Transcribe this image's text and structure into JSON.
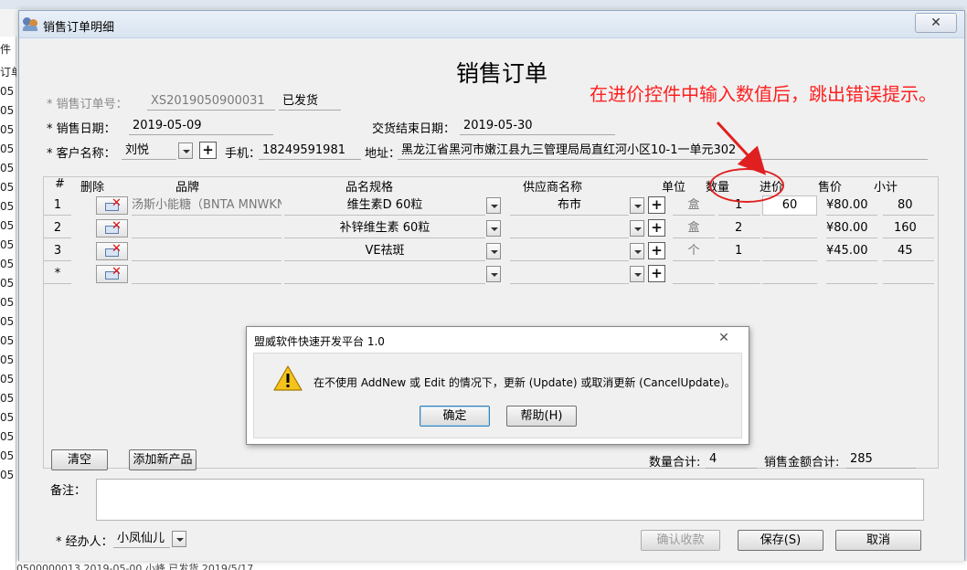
{
  "background": {
    "left_column": [
      "件",
      "",
      "订单",
      "05",
      "05",
      "05",
      "05",
      "05",
      "05",
      "05",
      "05",
      "05",
      "05",
      "05",
      "05",
      "05",
      "05",
      "05",
      "05",
      "05",
      "05",
      "05",
      "05",
      "05"
    ],
    "bottom_row": "0500000013    2019-05-00          小峰              已发货            2019/5/17"
  },
  "window": {
    "title": "销售订单明细",
    "close_glyph": "✕"
  },
  "form": {
    "heading": "销售订单",
    "annotation": "在进价控件中输入数值后，跳出错误提示。",
    "order_no_label": "* 销售订单号：",
    "order_no": "XS2019050900031",
    "status": "已发货",
    "sale_date_label": "* 销售日期：",
    "sale_date": "2019-05-09",
    "delivery_end_label": "交货结束日期：",
    "delivery_end": "2019-05-30",
    "customer_label": "* 客户名称：",
    "customer": "刘悦",
    "phone_label": "手机：",
    "phone": "18249591981",
    "address_label": "地址：",
    "address": "黑龙江省黑河市嫩江县九三管理局局直红河小区10-1一单元302"
  },
  "grid": {
    "headers": [
      "#",
      "删除",
      "品牌",
      "品名规格",
      "供应商名称",
      "单位",
      "数量",
      "进价",
      "售价",
      "小计"
    ],
    "rows": [
      {
        "num": "1",
        "brand": "汤斯小能糖（BNTA MNWKN",
        "product": "维生素D 60粒",
        "supplier": "布市",
        "unit": "盒",
        "qty": "1",
        "cost": "60",
        "price": "¥80.00",
        "subtotal": "80"
      },
      {
        "num": "2",
        "brand": "",
        "product": "补锌维生素 60粒",
        "supplier": "",
        "unit": "盒",
        "qty": "2",
        "cost": "",
        "price": "¥80.00",
        "subtotal": "160"
      },
      {
        "num": "3",
        "brand": "",
        "product": "VE祛斑",
        "supplier": "",
        "unit": "个",
        "qty": "1",
        "cost": "",
        "price": "¥45.00",
        "subtotal": "45"
      },
      {
        "num": "*",
        "brand": "",
        "product": "",
        "supplier": "",
        "unit": "",
        "qty": "",
        "cost": "",
        "price": "",
        "subtotal": ""
      }
    ],
    "clear_label": "清空",
    "add_product_label": "添加新产品",
    "qty_total_label": "数量合计:",
    "qty_total": "4",
    "amount_total_label": "销售金额合计:",
    "amount_total": "285"
  },
  "footer": {
    "remark_label": "备注：",
    "handler_label": "* 经办人：",
    "handler": "小凤仙儿",
    "confirm_label": "确认收款",
    "save_label": "保存(S)",
    "cancel_label": "取消"
  },
  "msgbox": {
    "title": "盟威软件快速开发平台 1.0",
    "close_glyph": "✕",
    "message": "在不使用 AddNew 或 Edit 的情况下，更新 (Update) 或取消更新 (CancelUpdate)。",
    "ok_label": "确定",
    "help_label": "帮助(H)"
  }
}
